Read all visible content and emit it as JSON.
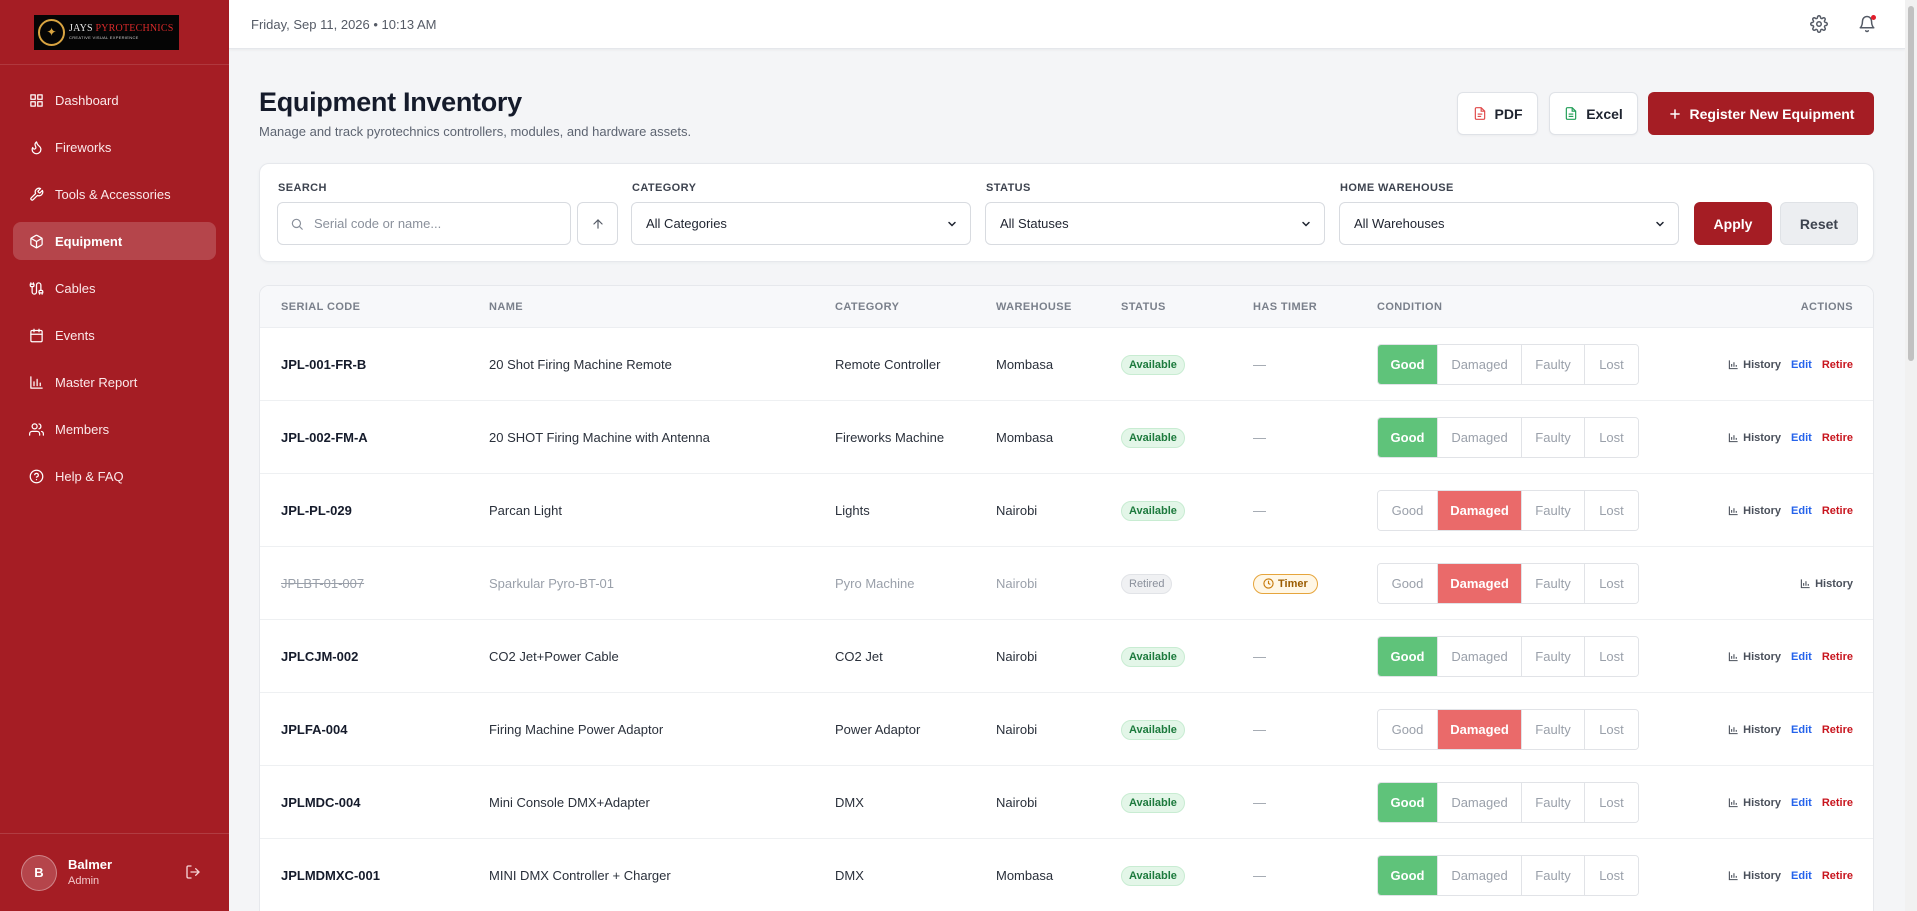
{
  "brand": {
    "name_a": "JAYS ",
    "name_b": "PYROTECHNICS",
    "tagline": "CREATIVE VISUAL EXPERIENCE"
  },
  "sidebar": {
    "items": [
      {
        "label": "Dashboard",
        "icon": "grid-icon"
      },
      {
        "label": "Fireworks",
        "icon": "flame-icon"
      },
      {
        "label": "Tools & Accessories",
        "icon": "wrench-icon"
      },
      {
        "label": "Equipment",
        "icon": "box-icon",
        "active": true
      },
      {
        "label": "Cables",
        "icon": "cable-icon"
      },
      {
        "label": "Events",
        "icon": "calendar-icon"
      },
      {
        "label": "Master Report",
        "icon": "bar-chart-icon"
      },
      {
        "label": "Members",
        "icon": "users-icon"
      },
      {
        "label": "Help & FAQ",
        "icon": "help-circle-icon"
      }
    ],
    "user": {
      "initial": "B",
      "name": "Balmer",
      "role": "Admin"
    }
  },
  "topbar": {
    "datetime": "Friday, Sep 11, 2026  •  10:13 AM"
  },
  "header": {
    "title": "Equipment Inventory",
    "subtitle": "Manage and track pyrotechnics controllers, modules, and hardware assets.",
    "pdf_label": "PDF",
    "excel_label": "Excel",
    "register_label": "Register New Equipment"
  },
  "filters": {
    "search_label": "SEARCH",
    "search_placeholder": "Serial code or name...",
    "category_label": "CATEGORY",
    "category_value": "All Categories",
    "status_label": "STATUS",
    "status_value": "All Statuses",
    "warehouse_label": "HOME WAREHOUSE",
    "warehouse_value": "All Warehouses",
    "apply_label": "Apply",
    "reset_label": "Reset"
  },
  "table": {
    "columns": {
      "serial": "SERIAL CODE",
      "name": "NAME",
      "category": "CATEGORY",
      "warehouse": "WAREHOUSE",
      "status": "STATUS",
      "timer": "HAS TIMER",
      "condition": "CONDITION",
      "actions": "ACTIONS"
    },
    "condition_options": [
      "Good",
      "Damaged",
      "Faulty",
      "Lost"
    ],
    "action_labels": {
      "history": "History",
      "edit": "Edit",
      "retire": "Retire"
    },
    "rows": [
      {
        "serial": "JPL-001-FR-B",
        "name": "20 Shot Firing Machine Remote",
        "category": "Remote Controller",
        "warehouse": "Mombasa",
        "status": "Available",
        "timer": "—",
        "condition": "Good",
        "retired": false
      },
      {
        "serial": "JPL-002-FM-A",
        "name": "20 SHOT Firing Machine with Antenna",
        "category": "Fireworks Machine",
        "warehouse": "Mombasa",
        "status": "Available",
        "timer": "—",
        "condition": "Good",
        "retired": false
      },
      {
        "serial": "JPL-PL-029",
        "name": "Parcan Light",
        "category": "Lights",
        "warehouse": "Nairobi",
        "status": "Available",
        "timer": "—",
        "condition": "Damaged",
        "retired": false
      },
      {
        "serial": "JPLBT-01-007",
        "name": "Sparkular Pyro-BT-01",
        "category": "Pyro Machine",
        "warehouse": "Nairobi",
        "status": "Retired",
        "timer": "Timer",
        "condition": "Damaged",
        "retired": true
      },
      {
        "serial": "JPLCJM-002",
        "name": "CO2 Jet+Power Cable",
        "category": "CO2 Jet",
        "warehouse": "Nairobi",
        "status": "Available",
        "timer": "—",
        "condition": "Good",
        "retired": false
      },
      {
        "serial": "JPLFA-004",
        "name": "Firing Machine Power Adaptor",
        "category": "Power Adaptor",
        "warehouse": "Nairobi",
        "status": "Available",
        "timer": "—",
        "condition": "Damaged",
        "retired": false
      },
      {
        "serial": "JPLMDC-004",
        "name": "Mini Console DMX+Adapter",
        "category": "DMX",
        "warehouse": "Nairobi",
        "status": "Available",
        "timer": "—",
        "condition": "Good",
        "retired": false
      },
      {
        "serial": "JPLMDMXC-001",
        "name": "MINI DMX Controller + Charger",
        "category": "DMX",
        "warehouse": "Mombasa",
        "status": "Available",
        "timer": "—",
        "condition": "Good",
        "retired": false
      }
    ]
  },
  "colors": {
    "brand_red": "#a51d24",
    "good_green": "#5fc37a",
    "damaged_red": "#ea6a6a"
  }
}
